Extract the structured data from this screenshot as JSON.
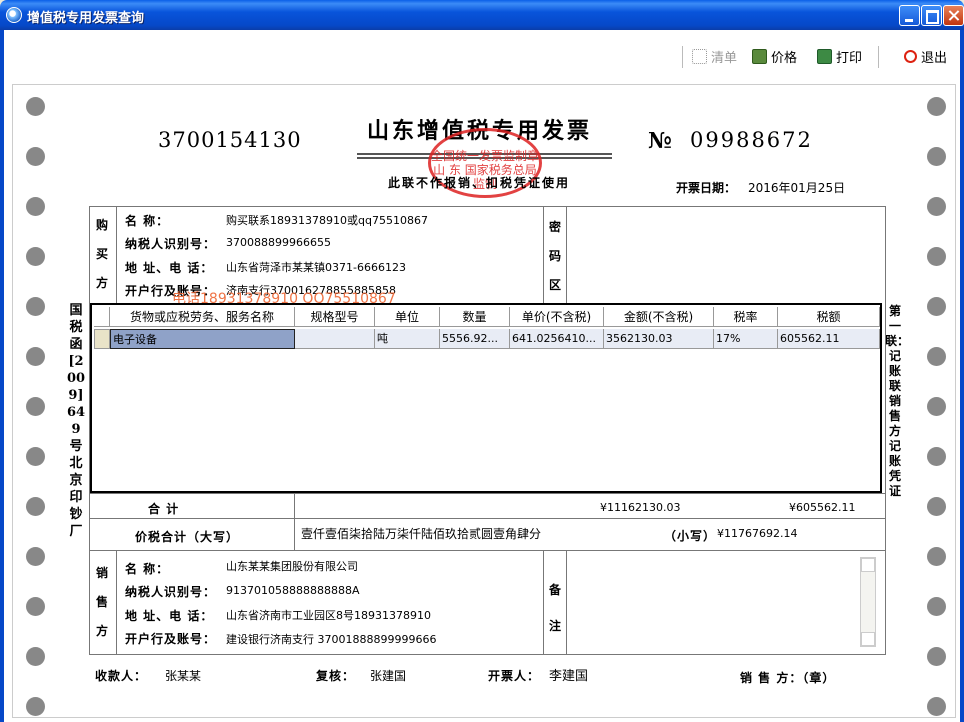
{
  "window": {
    "title": "增值税专用发票查询"
  },
  "toolbar": {
    "list_label": "清单",
    "price_label": "价格",
    "print_label": "打印",
    "exit_label": "退出"
  },
  "invoice": {
    "code": "3700154130",
    "title": "山东增值税专用发票",
    "stamp_text": "全国统一发票监制章 山 东 国家税务总局监制",
    "subtitle": "此联不作报销、扣税凭证使用",
    "no_label": "№",
    "number": "09988672",
    "date_label": "开票日期：",
    "date": "2016年01月25日",
    "left_vertical": "国税函[2009]649号北京印钞厂",
    "right_vertical": "第一联：记账联 销售方记账凭证",
    "buyer": {
      "side_label": "购买方",
      "name_label": "名    称：",
      "name": "购买联系18931378910或qq75510867",
      "taxid_label": "纳税人识别号：",
      "taxid": "370088899966655",
      "address_label": "地 址、电 话：",
      "address": "山东省菏泽市某某镇0371-6666123",
      "bank_label": "开户行及账号：",
      "bank": "济南支行370016278855885858"
    },
    "password_label": "密码区",
    "watermark": "电话18931378910     QQ75510867",
    "table": {
      "headers": [
        "货物或应税劳务、服务名称",
        "规格型号",
        "单位",
        "数量",
        "单价(不含税)",
        "金额(不含税)",
        "税率",
        "税额"
      ],
      "rows": [
        [
          "电子设备",
          "",
          "吨",
          "5556.92...",
          "641.0256410...",
          "3562130.03",
          "17%",
          "605562.11"
        ]
      ]
    },
    "totals": {
      "label": "合        计",
      "amount": "¥11162130.03",
      "tax": "¥605562.11",
      "in_words_label": "价税合计（大写）",
      "in_words": "壹仟壹佰柒拾陆万柒仟陆佰玖拾贰圆壹角肆分",
      "small_label": "（小写）",
      "small_value": "¥11767692.14"
    },
    "seller": {
      "side_label": "销售方",
      "name_label": "名    称：",
      "name": "山东某某集团股份有限公司",
      "taxid_label": "纳税人识别号：",
      "taxid": "913701058888888888A",
      "address_label": "地 址、电 话：",
      "address": "山东省济南市工业园区8号18931378910",
      "bank_label": "开户行及账号：",
      "bank": "建设银行济南支行 37001888899999666"
    },
    "remark_label": "备注",
    "footer": {
      "payee_label": "收款人：",
      "payee": "张某某",
      "review_label": "复核：",
      "review": "张建国",
      "issuer_label": "开票人：",
      "issuer": "李建国",
      "seller_label": "销 售 方：（章）"
    }
  }
}
